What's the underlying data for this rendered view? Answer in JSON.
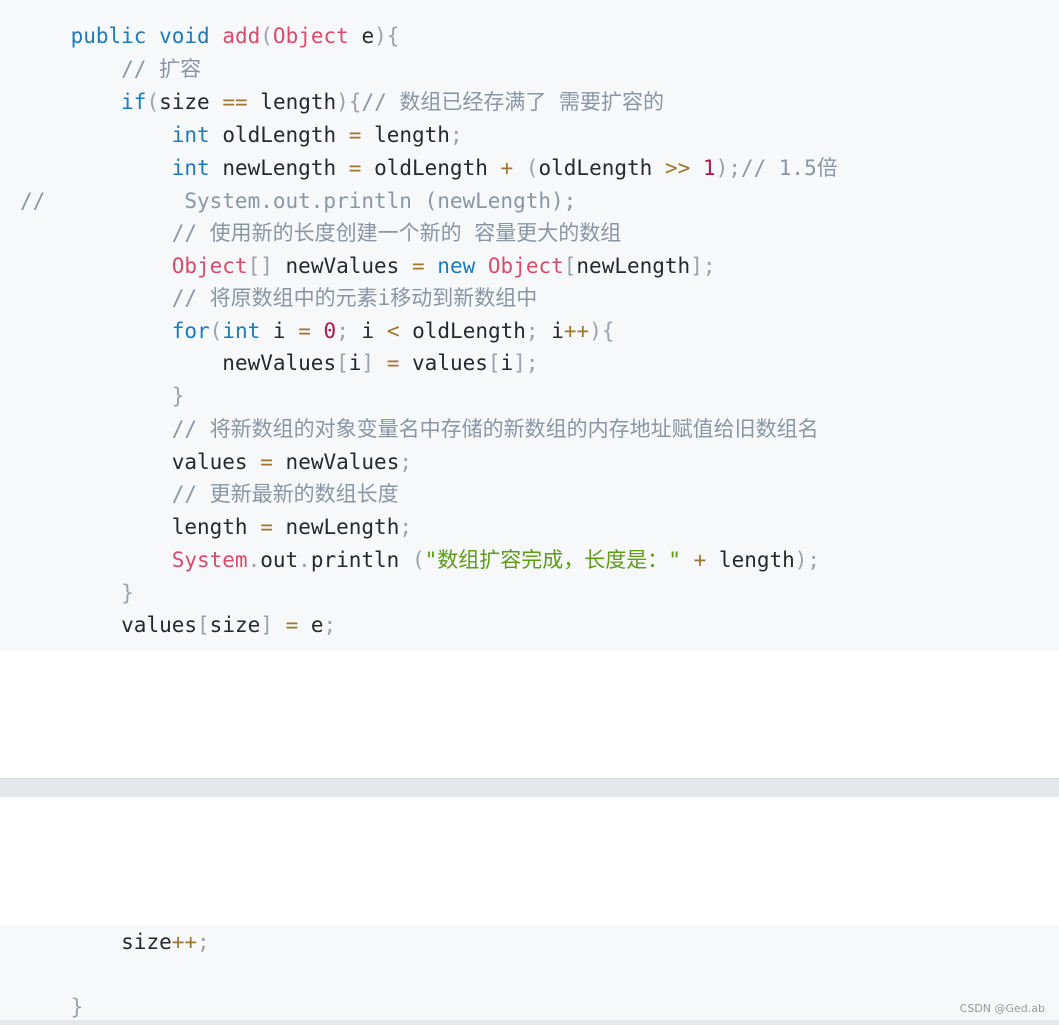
{
  "code_top": {
    "line1": {
      "kw1": "public",
      "kw2": "void",
      "fn": "add",
      "p1": "(",
      "typ": "Object",
      "arg": "e",
      "p2": "){"
    },
    "line2": {
      "cm": "// 扩容"
    },
    "line3": {
      "kw": "if",
      "p1": "(",
      "id1": "size",
      "op": "==",
      "id2": "length",
      "p2": "){",
      "cm": "// 数组已经存满了 需要扩容的"
    },
    "line4": {
      "kw": "int",
      "id1": "oldLength",
      "op": "=",
      "id2": "length",
      "p": ";"
    },
    "line5": {
      "kw": "int",
      "id1": "newLength",
      "op1": "=",
      "id2": "oldLength",
      "op2": "+",
      "p1": "(",
      "id3": "oldLength",
      "op3": ">>",
      "num": "1",
      "p2": ");",
      "cm": "// 1.5倍"
    },
    "line6": {
      "cm": "//           System.out.println (newLength);"
    },
    "line7": {
      "cm": "// 使用新的长度创建一个新的 容量更大的数组"
    },
    "line8": {
      "typ1": "Object",
      "p1": "[]",
      "id1": "newValues",
      "op": "=",
      "kw": "new",
      "typ2": "Object",
      "p2": "[",
      "id2": "newLength",
      "p3": "];"
    },
    "line9": {
      "cm": "// 将原数组中的元素i移动到新数组中"
    },
    "line10": {
      "kw1": "for",
      "p1": "(",
      "kw2": "int",
      "id1": "i",
      "op1": "=",
      "num": "0",
      "p2": ";",
      "id2": "i",
      "op2": "<",
      "id3": "oldLength",
      "p3": ";",
      "id4": "i",
      "op3": "++",
      "p4": "){"
    },
    "line11": {
      "id1": "newValues",
      "p1": "[",
      "id2": "i",
      "p2": "]",
      "op": "=",
      "id3": "values",
      "p3": "[",
      "id4": "i",
      "p4": "];"
    },
    "line12": {
      "p": "}"
    },
    "line13": {
      "cm": "// 将新数组的对象变量名中存储的新数组的内存地址赋值给旧数组名"
    },
    "line14": {
      "id1": "values",
      "op": "=",
      "id2": "newValues",
      "p": ";"
    },
    "line15": {
      "cm": "// 更新最新的数组长度"
    },
    "line16": {
      "id1": "length",
      "op": "=",
      "id2": "newLength",
      "p": ";"
    },
    "line17": {
      "typ": "System",
      "p1": ".",
      "id1": "out",
      "p2": ".",
      "id2": "println",
      "p3": "(",
      "str": "\"数组扩容完成，长度是：\"",
      "op": "+",
      "id3": "length",
      "p4": ");"
    },
    "line18": {
      "p": "}"
    },
    "line19": {
      "id1": "values",
      "p1": "[",
      "id2": "size",
      "p2": "]",
      "op": "=",
      "id3": "e",
      "p3": ";"
    }
  },
  "code_bottom": {
    "line1": {
      "id": "size",
      "op": "++",
      "p": ";"
    },
    "line2": {
      "p": "}"
    }
  },
  "watermark": "CSDN @Ged.ab",
  "colors": {
    "background": "#f7f8fa",
    "keyword": "#1a7bbf",
    "type": "#d94b6c",
    "comment": "#8a96a3",
    "string": "#5f9b1a",
    "number": "#b0164a",
    "operator": "#a0742d"
  }
}
